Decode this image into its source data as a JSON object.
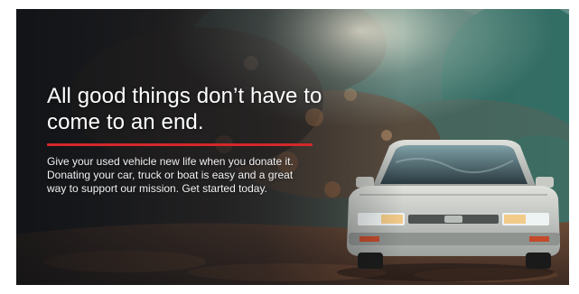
{
  "banner": {
    "headline": "All good things don’t have to come to an end.",
    "body": "Give your used vehicle new life when you donate it. Donating your car, truck or boat is easy and a great way to support our mission. Get started today.",
    "colors": {
      "divider": "#d3282a",
      "text": "#ffffff",
      "foliage": "#2f6b62",
      "car": "#c9ccc6"
    }
  }
}
